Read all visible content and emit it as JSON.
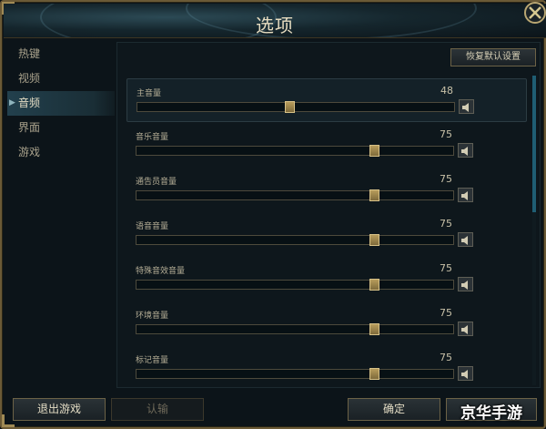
{
  "window": {
    "title": "选项",
    "close_icon": "close-icon"
  },
  "sidebar": {
    "items": [
      {
        "label": "热键",
        "active": false
      },
      {
        "label": "视频",
        "active": false
      },
      {
        "label": "音频",
        "active": true
      },
      {
        "label": "界面",
        "active": false
      },
      {
        "label": "游戏",
        "active": false
      }
    ]
  },
  "content": {
    "reset_label": "恢复默认设置",
    "volumes": [
      {
        "label": "主音量",
        "value": "48",
        "level": 48
      },
      {
        "label": "音乐音量",
        "value": "75",
        "level": 75
      },
      {
        "label": "通告员音量",
        "value": "75",
        "level": 75
      },
      {
        "label": "语音音量",
        "value": "75",
        "level": 75
      },
      {
        "label": "特殊音效音量",
        "value": "75",
        "level": 75
      },
      {
        "label": "环境音量",
        "value": "75",
        "level": 75
      },
      {
        "label": "标记音量",
        "value": "75",
        "level": 75
      }
    ],
    "mute_icon": "speaker-icon"
  },
  "footer": {
    "exit_label": "退出游戏",
    "confirm_label": "认输",
    "ok_label": "确定"
  },
  "watermark": "京华手游",
  "colors": {
    "accent_gold": "#a08a55",
    "active_tab": "#22404d",
    "scroll_thumb": "#1f5e73"
  }
}
